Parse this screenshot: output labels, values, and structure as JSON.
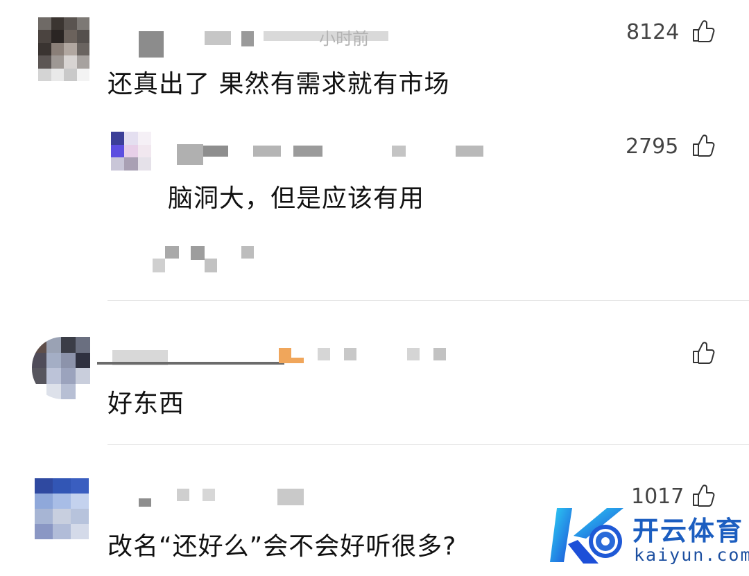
{
  "comments": [
    {
      "text": "还真出了 果然有需求就有市场",
      "likes": "8124",
      "time_hint": "小时前",
      "replies": [
        {
          "text": "脑洞大，但是应该有用",
          "likes": "2795"
        }
      ]
    },
    {
      "text": "好东西",
      "likes": ""
    },
    {
      "text": "改名“还好么”会不会好听很多?",
      "likes": "1017"
    }
  ],
  "icons": {
    "like": "thumbs-up-icon"
  },
  "watermark": {
    "title": "开云体育",
    "url": "kaiyun.com"
  },
  "colors": {
    "text": "#111111",
    "count": "#444444",
    "divider": "#e6e6e6",
    "brand": "#1c5ec0"
  }
}
